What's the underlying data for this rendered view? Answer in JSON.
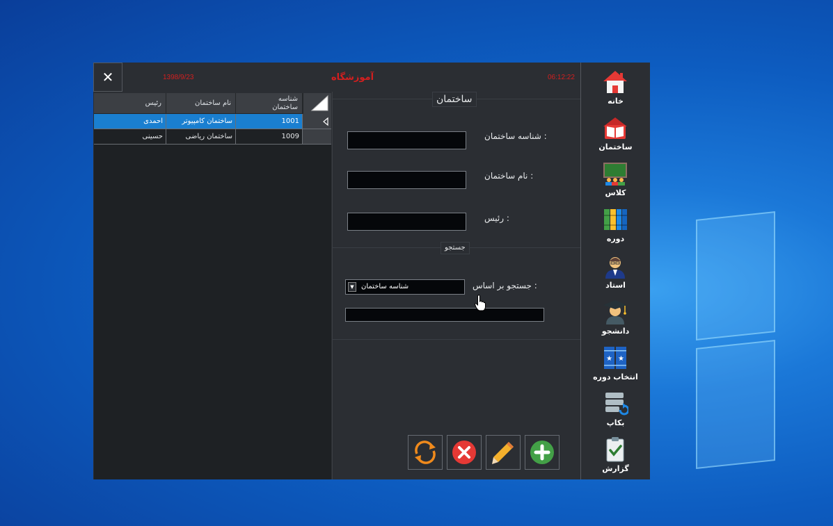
{
  "window": {
    "close_symbol": "✕",
    "date": "1398/9/23",
    "title": "آموزشگاه",
    "time": "06:12:22",
    "title_color": "#d41f1f"
  },
  "grid": {
    "columns": [
      "شناسه ساختمان",
      "نام ساختمان",
      "رئیس"
    ],
    "rows": [
      {
        "id": "1001",
        "name": "ساختمان کامپیوتر",
        "head": "احمدی",
        "selected": true
      },
      {
        "id": "1009",
        "name": "ساختمان ریاضی",
        "head": "حسینی",
        "selected": false
      }
    ],
    "selected_color": "#1a7fd0"
  },
  "form": {
    "group_title": "ساختمان",
    "fields": [
      {
        "label": "شناسه ساختمان  :",
        "value": ""
      },
      {
        "label": "نام ساختمان  :",
        "value": ""
      },
      {
        "label": "رئیس  :",
        "value": ""
      }
    ],
    "search": {
      "group_title": "جستجو",
      "by_label": "جستجو بر اساس :",
      "by_selected": "شناسه ساختمان",
      "query_value": ""
    },
    "actions": [
      {
        "name": "refresh-button",
        "icon": "refresh-icon"
      },
      {
        "name": "delete-button",
        "icon": "delete-icon"
      },
      {
        "name": "edit-button",
        "icon": "pencil-icon"
      },
      {
        "name": "add-button",
        "icon": "plus-icon"
      }
    ]
  },
  "sidebar": {
    "items": [
      {
        "label": "خانه",
        "icon": "home-icon"
      },
      {
        "label": "ساختمان",
        "icon": "book-icon"
      },
      {
        "label": "کلاس",
        "icon": "classroom-icon"
      },
      {
        "label": "دوره",
        "icon": "books-icon"
      },
      {
        "label": "استاد",
        "icon": "teacher-icon"
      },
      {
        "label": "دانشجو",
        "icon": "student-icon"
      },
      {
        "label": "انتخاب دوره",
        "icon": "course-select-icon"
      },
      {
        "label": "بکاپ",
        "icon": "backup-icon"
      },
      {
        "label": "گزارش",
        "icon": "report-icon"
      }
    ]
  }
}
